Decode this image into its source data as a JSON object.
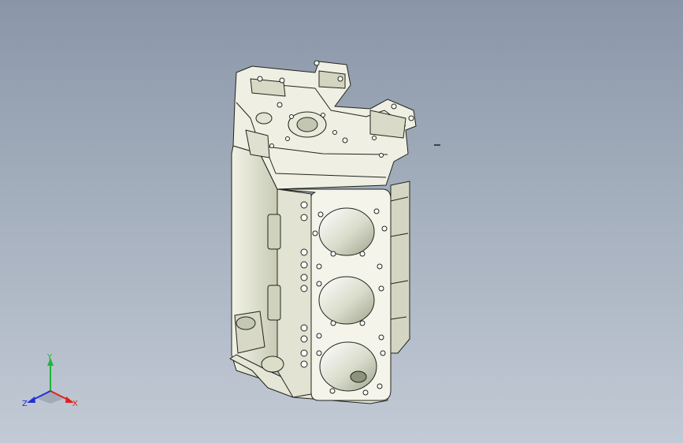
{
  "viewport": {
    "background_top": "#8a96a8",
    "background_bottom": "#c2cad5"
  },
  "model": {
    "kind": "engine-block",
    "cylinder_bores_visible": 3,
    "body_color": "#efefe2",
    "shadow_color": "#b9bda9",
    "edge_color": "#20251c"
  },
  "triad": {
    "x_label": "X",
    "y_label": "Y",
    "z_label": "Z",
    "x_color": "#e01e1e",
    "y_color": "#1eb43a",
    "z_color": "#2030d8"
  }
}
